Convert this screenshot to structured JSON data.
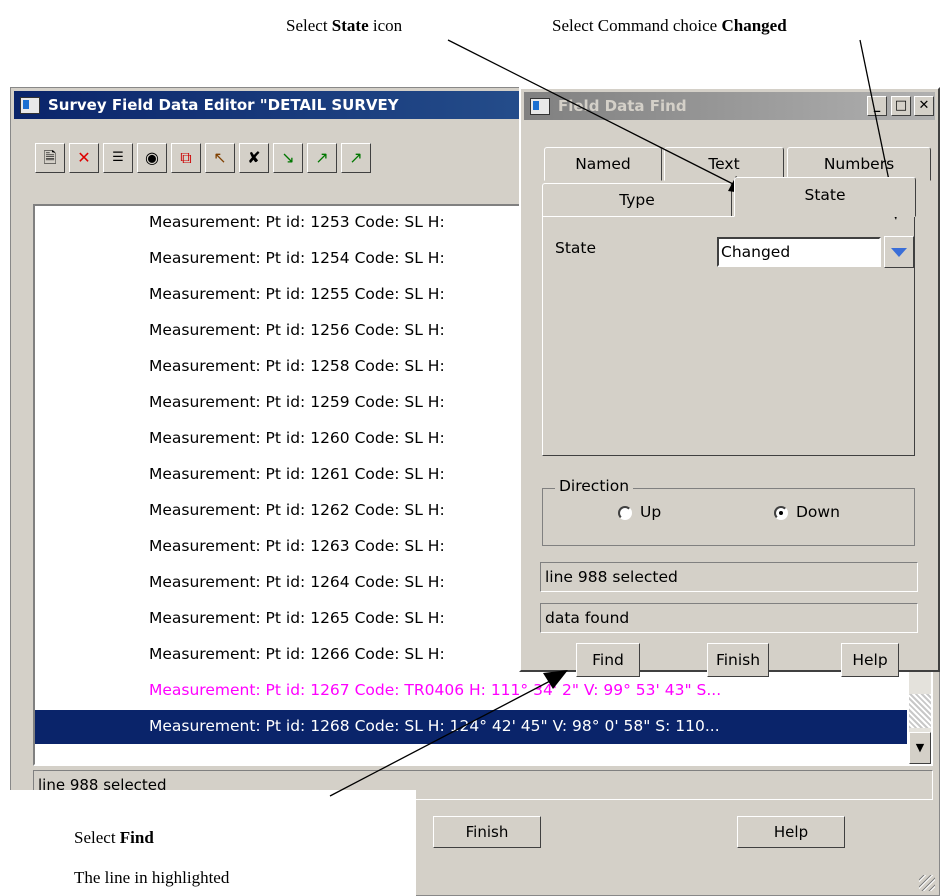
{
  "annotations": {
    "select_state_prefix": "Select ",
    "select_state_bold": "State",
    "select_state_suffix": " icon",
    "select_cmd_prefix": "Select Command choice ",
    "select_cmd_bold": "Changed",
    "select_find_prefix": "Select ",
    "select_find_bold": "Find",
    "highlight_note": "The line in highlighted"
  },
  "main_window": {
    "title": "Survey Field Data Editor \"DETAIL SURVEY",
    "toolbar_icons": [
      "new-document-icon",
      "delete-icon",
      "list-icon",
      "binoculars-icon",
      "copy-icon",
      "pointer-icon",
      "cross-tool-icon",
      "instrument-icon",
      "survey-point-icon",
      "survey-line-icon"
    ],
    "rows": [
      "Measurement:  Pt id: 1253 Code: SL H:",
      "Measurement:  Pt id: 1254 Code: SL H:",
      "Measurement:  Pt id: 1255 Code: SL H:",
      "Measurement:  Pt id: 1256 Code: SL H:",
      "Measurement:  Pt id: 1258 Code: SL H:",
      "Measurement:  Pt id: 1259 Code: SL H:",
      "Measurement:  Pt id: 1260 Code: SL H:",
      "Measurement:  Pt id: 1261 Code: SL H:",
      "Measurement:  Pt id: 1262 Code: SL H:",
      "Measurement:  Pt id: 1263 Code: SL H:",
      "Measurement:  Pt id: 1264 Code: SL H:",
      "Measurement:  Pt id: 1265 Code: SL H:",
      "Measurement:  Pt id: 1266 Code: SL H:",
      "Measurement:  Pt id: 1267 Code: TR0406 H:   111° 34'  2\" V:   99° 53' 43\" S...",
      "Measurement:  Pt id: 1268 Code: SL H:  124° 42' 45\" V:   98°  0' 58\" S: 110..."
    ],
    "status": "line 988 selected",
    "finish_label": "Finish",
    "help_label": "Help"
  },
  "find_dialog": {
    "title": "Field Data Find",
    "tabs_back": [
      "Named",
      "Text",
      "Numbers"
    ],
    "tabs_front": [
      "Type",
      "State"
    ],
    "state_label": "State",
    "state_value": "Changed",
    "direction_label": "Direction",
    "radio_up": "Up",
    "radio_down": "Down",
    "direction_selected": "Down",
    "message1": "line 988 selected",
    "message2": "data found",
    "find_label": "Find",
    "finish_label": "Finish",
    "help_label": "Help"
  },
  "colors": {
    "active_title": "#0a246a",
    "selected_row": "#0a246a",
    "magenta_row": "#ff00ff",
    "dropdown_arrow": "#3a6ed8"
  }
}
